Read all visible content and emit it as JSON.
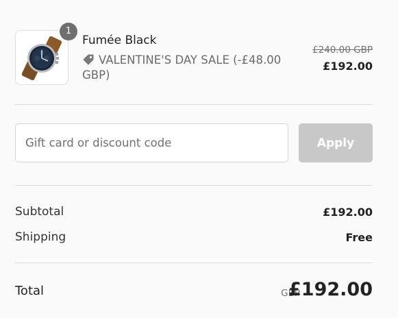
{
  "line_item": {
    "quantity": "1",
    "name": "Fumée Black",
    "discount_text": "VALENTINE'S DAY SALE (-£48.00 GBP)",
    "original_price": "£240.00 GBP",
    "sale_price": "£192.00",
    "thumbnail_icon": "watch-image",
    "tag_icon": "price-tag-icon"
  },
  "discount": {
    "placeholder": "Gift card or discount code",
    "value": "",
    "apply_label": "Apply"
  },
  "summary": {
    "subtotal_label": "Subtotal",
    "subtotal_value": "£192.00",
    "shipping_label": "Shipping",
    "shipping_value": "Free"
  },
  "total": {
    "label": "Total",
    "currency": "GBP",
    "amount": "£192.00"
  }
}
